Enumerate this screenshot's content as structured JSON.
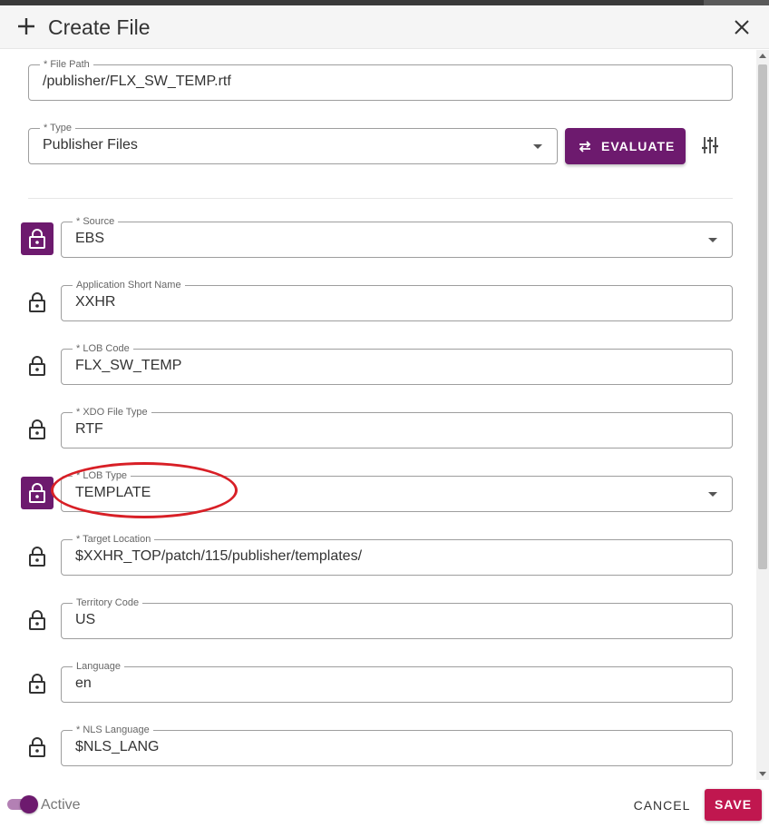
{
  "dialog": {
    "title": "Create File",
    "icons": {
      "title": "plus-icon",
      "close": "close-icon"
    }
  },
  "form": {
    "file_path": {
      "label": "* File Path",
      "value": "/publisher/FLX_SW_TEMP.rtf"
    },
    "type": {
      "label": "* Type",
      "value": "Publisher Files"
    },
    "evaluate_label": "EVALUATE",
    "fields": [
      {
        "label": "* Source",
        "value": "EBS",
        "dropdown": true,
        "locked": true
      },
      {
        "label": "Application Short Name",
        "value": "XXHR",
        "dropdown": false,
        "locked": false
      },
      {
        "label": "* LOB Code",
        "value": "FLX_SW_TEMP",
        "dropdown": false,
        "locked": false
      },
      {
        "label": "* XDO File Type",
        "value": "RTF",
        "dropdown": false,
        "locked": false
      },
      {
        "label": "* LOB Type",
        "value": "TEMPLATE",
        "dropdown": true,
        "locked": true
      },
      {
        "label": "* Target Location",
        "value": "$XXHR_TOP/patch/115/publisher/templates/",
        "dropdown": false,
        "locked": false
      },
      {
        "label": "Territory Code",
        "value": "US",
        "dropdown": false,
        "locked": false
      },
      {
        "label": "Language",
        "value": "en",
        "dropdown": false,
        "locked": false
      },
      {
        "label": "* NLS Language",
        "value": "$NLS_LANG",
        "dropdown": false,
        "locked": false
      }
    ]
  },
  "footer": {
    "active_label": "Active",
    "active": true,
    "cancel_label": "CANCEL",
    "save_label": "SAVE"
  },
  "colors": {
    "accent": "#6d1a6e",
    "save": "#c0174f",
    "highlight": "#d81f26"
  }
}
